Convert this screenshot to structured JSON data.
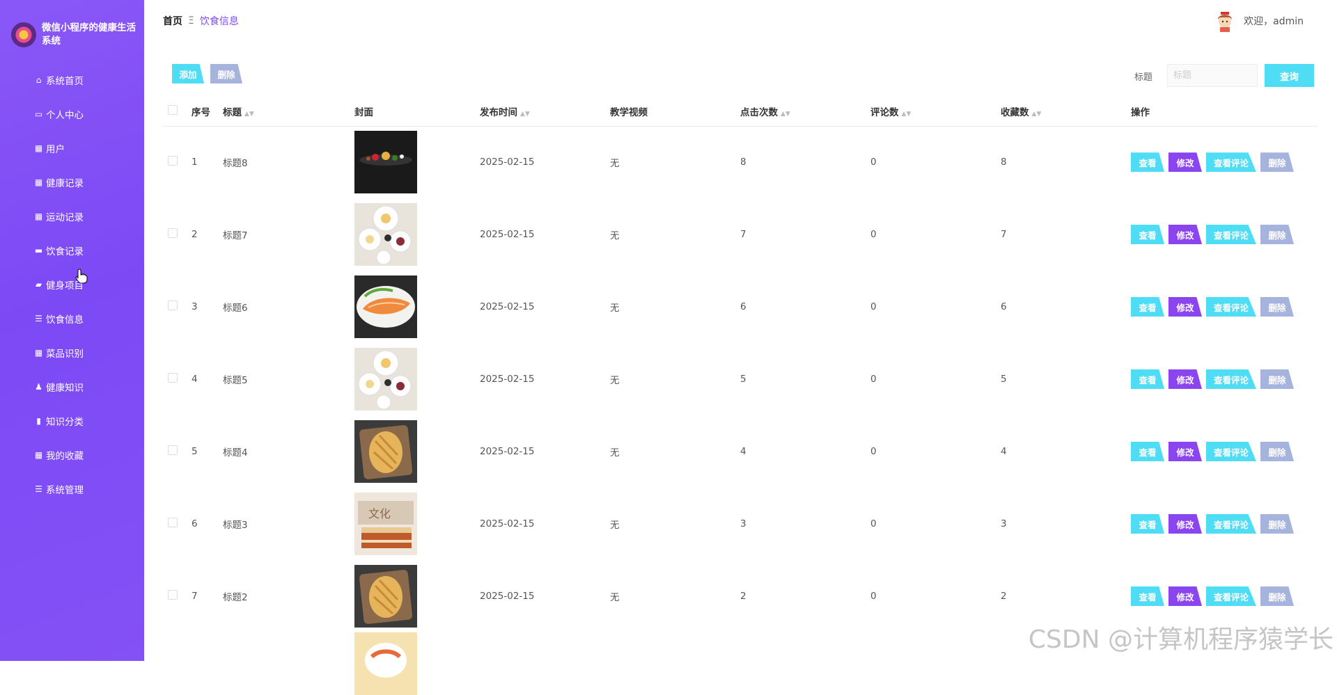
{
  "brand": {
    "name": "微信小程序的健康生活系统"
  },
  "sidebar": {
    "items": [
      {
        "label": "系统首页",
        "icon": "home-icon"
      },
      {
        "label": "个人中心",
        "icon": "id-card-icon"
      },
      {
        "label": "用户",
        "icon": "grid-icon"
      },
      {
        "label": "健康记录",
        "icon": "grid-icon"
      },
      {
        "label": "运动记录",
        "icon": "grid-icon"
      },
      {
        "label": "饮食记录",
        "icon": "monitor-icon"
      },
      {
        "label": "健身项目",
        "icon": "folder-icon"
      },
      {
        "label": "饮食信息",
        "icon": "list-icon"
      },
      {
        "label": "菜品识别",
        "icon": "grid-icon"
      },
      {
        "label": "健康知识",
        "icon": "user-icon"
      },
      {
        "label": "知识分类",
        "icon": "clipboard-icon"
      },
      {
        "label": "我的收藏",
        "icon": "grid-icon"
      },
      {
        "label": "系统管理",
        "icon": "list-icon"
      }
    ]
  },
  "breadcrumb": {
    "home": "首页",
    "separator": "Ξ",
    "current": "饮食信息"
  },
  "user": {
    "greeting": "欢迎，admin"
  },
  "toolbar": {
    "add_label": "添加",
    "delete_label": "删除"
  },
  "search": {
    "label": "标题",
    "placeholder": "标题",
    "button_label": "查询"
  },
  "table": {
    "columns": [
      "序号",
      "标题",
      "封面",
      "发布时间",
      "教学视频",
      "点击次数",
      "评论数",
      "收藏数",
      "操作"
    ],
    "actions": {
      "view": "查看",
      "edit": "修改",
      "comments": "查看评论",
      "delete": "删除"
    },
    "rows": [
      {
        "index": "1",
        "title": "标题8",
        "date": "2025-02-15",
        "video": "无",
        "clicks": "8",
        "comments": "0",
        "favorites": "8",
        "cover": "dark-plate"
      },
      {
        "index": "2",
        "title": "标题7",
        "date": "2025-02-15",
        "video": "无",
        "clicks": "7",
        "comments": "0",
        "favorites": "7",
        "cover": "white-plates"
      },
      {
        "index": "3",
        "title": "标题6",
        "date": "2025-02-15",
        "video": "无",
        "clicks": "6",
        "comments": "0",
        "favorites": "6",
        "cover": "salmon-plate"
      },
      {
        "index": "4",
        "title": "标题5",
        "date": "2025-02-15",
        "video": "无",
        "clicks": "5",
        "comments": "0",
        "favorites": "5",
        "cover": "white-plates"
      },
      {
        "index": "5",
        "title": "标题4",
        "date": "2025-02-15",
        "video": "无",
        "clicks": "4",
        "comments": "0",
        "favorites": "4",
        "cover": "bread-board"
      },
      {
        "index": "6",
        "title": "标题3",
        "date": "2025-02-15",
        "video": "无",
        "clicks": "3",
        "comments": "0",
        "favorites": "3",
        "cover": "cake"
      },
      {
        "index": "7",
        "title": "标题2",
        "date": "2025-02-15",
        "video": "无",
        "clicks": "2",
        "comments": "0",
        "favorites": "2",
        "cover": "bread-board"
      }
    ]
  },
  "watermark": "CSDN @计算机程序猿学长",
  "colors": {
    "sidebar": "#7d49f5",
    "accent_cyan": "#4fdcf5",
    "accent_purple": "#8a45ee",
    "muted_blue": "#a6b3dc"
  }
}
